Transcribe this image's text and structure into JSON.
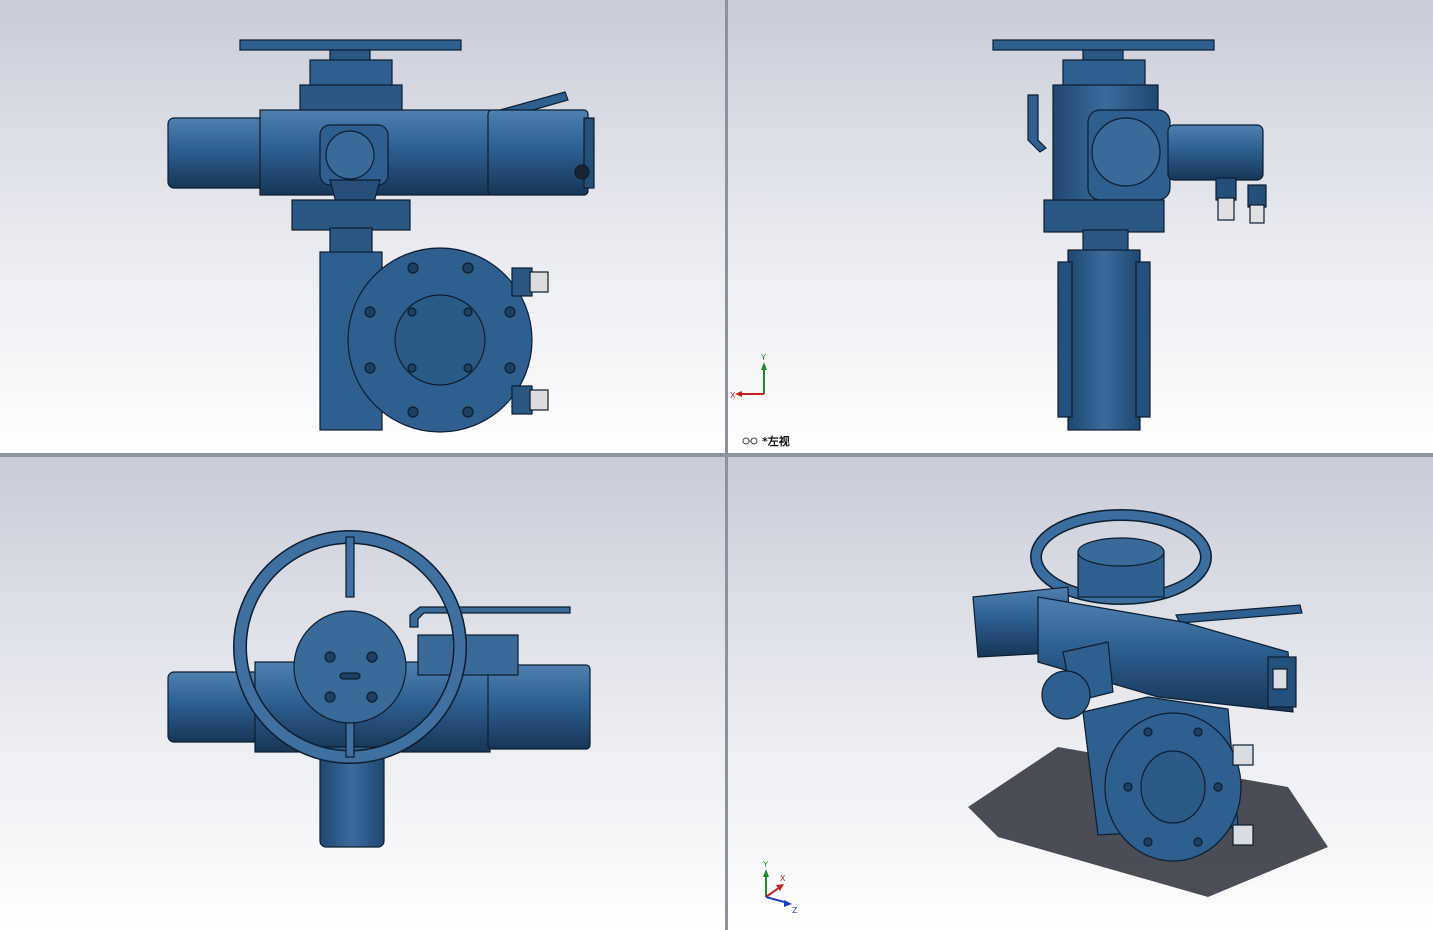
{
  "viewports": {
    "left_view": {
      "label": "*左视",
      "triad": {
        "y": "Y",
        "x": "X"
      }
    },
    "iso_view": {
      "triad": {
        "y": "Y",
        "x": "X",
        "z": "Z"
      }
    }
  },
  "colors": {
    "model_blue": "#2e5f8f",
    "model_dark": "#1d3f63",
    "model_edge": "#0c1d30",
    "background_top": "#c8ccd8",
    "background_bottom": "#ffffff"
  },
  "icons": {
    "view_orientation": "glasses-icon",
    "triad": "coordinate-triad-icon"
  }
}
